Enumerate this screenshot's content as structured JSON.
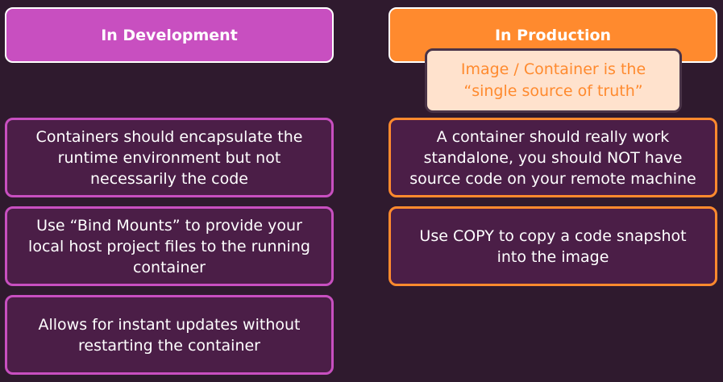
{
  "columns": [
    {
      "title": "In Development",
      "cards": [
        "Containers should encapsulate the\nruntime environment but not\nnecessarily the code",
        "Use “Bind Mounts” to provide your\nlocal host project files to the running\ncontainer",
        "Allows for instant updates without\nrestarting the container"
      ]
    },
    {
      "title": "In Production",
      "callout": "Image / Container is the\n“single source of truth”",
      "cards": [
        "A container should really work\nstandalone, you should NOT have\nsource code on your remote machine",
        "Use COPY to copy a code snapshot\ninto the image"
      ]
    }
  ],
  "colors": {
    "background": "#2f1a2e",
    "development_accent": "#c84fc0",
    "production_accent": "#ff8a2e",
    "card_fill": "#4b1e47",
    "callout_fill": "#ffe2cd"
  }
}
